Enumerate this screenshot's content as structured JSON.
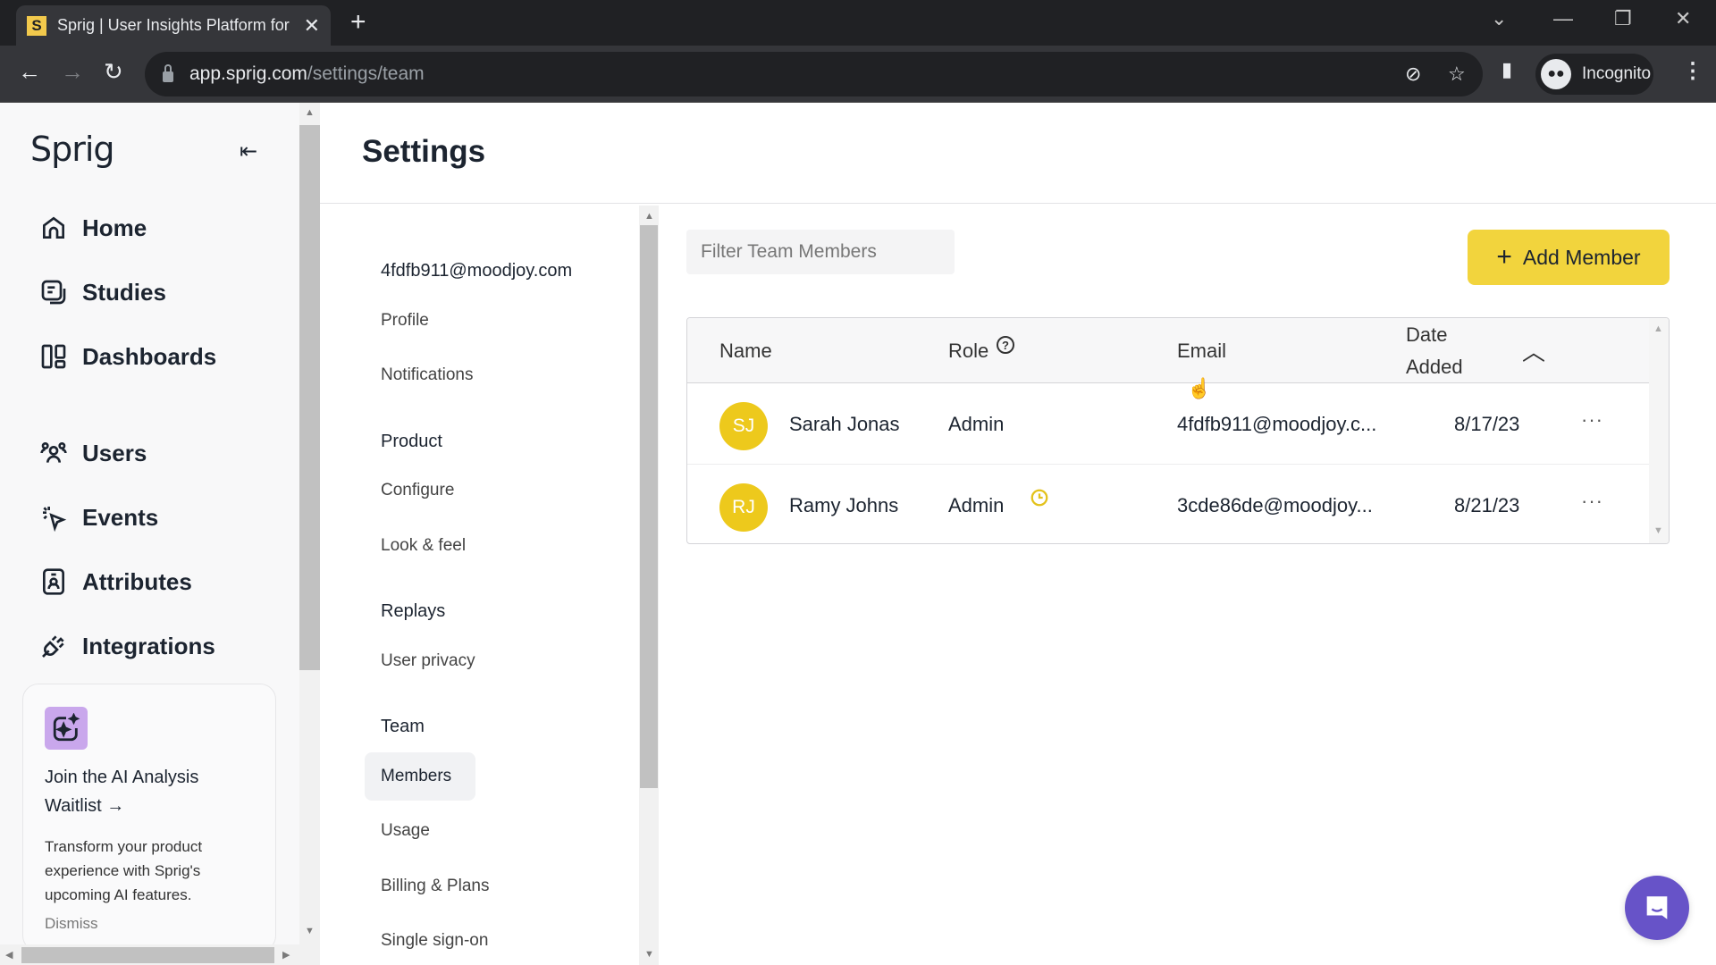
{
  "browser": {
    "tab_favicon": "S",
    "tab_title": "Sprig | User Insights Platform for",
    "url_host": "app.sprig.com",
    "url_path": "/settings/team",
    "profile_label": "Incognito"
  },
  "sidebar": {
    "logo": "Sprig",
    "items": [
      {
        "label": "Home",
        "icon": "home-icon"
      },
      {
        "label": "Studies",
        "icon": "studies-icon"
      },
      {
        "label": "Dashboards",
        "icon": "dashboards-icon"
      },
      {
        "label": "Users",
        "icon": "users-icon"
      },
      {
        "label": "Events",
        "icon": "events-icon"
      },
      {
        "label": "Attributes",
        "icon": "attributes-icon"
      },
      {
        "label": "Integrations",
        "icon": "integrations-icon"
      }
    ],
    "promo": {
      "title": "Join the AI Analysis Waitlist →",
      "text": "Transform your product experience with Sprig's upcoming AI features.",
      "dismiss": "Dismiss",
      "icon_color": "#c9a7ec"
    }
  },
  "settings": {
    "title": "Settings",
    "nav": {
      "account_email": "4fdfb911@moodjoy.com",
      "account_items": [
        "Profile",
        "Notifications"
      ],
      "groups": [
        {
          "label": "Product",
          "items": [
            "Configure",
            "Look & feel"
          ]
        },
        {
          "label": "Replays",
          "items": [
            "User privacy"
          ]
        },
        {
          "label": "Team",
          "items": [
            "Members",
            "Usage",
            "Billing & Plans",
            "Single sign-on"
          ]
        }
      ],
      "active": "Members"
    }
  },
  "members": {
    "filter_placeholder": "Filter Team Members",
    "filter_value": "",
    "add_button": "Add Member",
    "columns": {
      "name": "Name",
      "role": "Role",
      "email": "Email",
      "date_added_line1": "Date",
      "date_added_line2": "Added"
    },
    "sort": "date-added-ascending",
    "rows": [
      {
        "initials": "SJ",
        "name": "Sarah Jonas",
        "role": "Admin",
        "pending": false,
        "email": "4fdfb911@moodjoy.c...",
        "date_added": "8/17/23"
      },
      {
        "initials": "RJ",
        "name": "Ramy Johns",
        "role": "Admin",
        "pending": true,
        "email": "3cde86de@moodjoy...",
        "date_added": "8/21/23"
      }
    ],
    "accent_color": "#edc91c",
    "button_color": "#f2d43d"
  },
  "chat_widget_color": "#6753c8"
}
